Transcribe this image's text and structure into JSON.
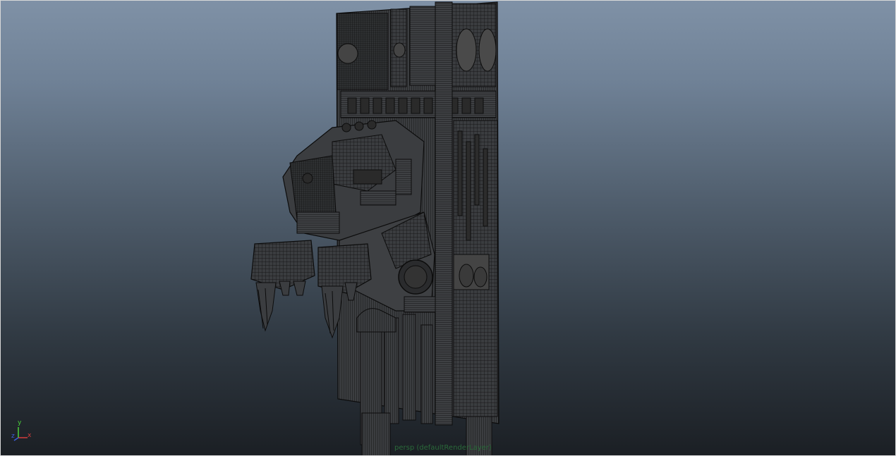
{
  "viewport": {
    "camera_label": "persp (defaultRenderLayer)",
    "view_mode": "wireframe-on-shaded",
    "background_top_color": "#7f91a6",
    "background_bottom_color": "#1b1f24",
    "border_color": "#d8d8d8",
    "mesh_color": "#3b3d40",
    "wire_color": "#0c0c0c",
    "label_color": "#2a6a3a"
  },
  "axis_gizmo": {
    "y_label": "y",
    "x_label": "x",
    "z_label": "z",
    "y_color": "#4bd13b",
    "x_color": "#d43c3c",
    "z_color": "#3d5ee0"
  }
}
